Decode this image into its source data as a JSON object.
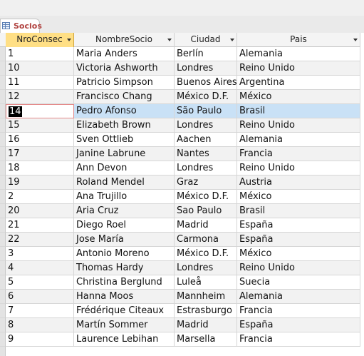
{
  "tab": {
    "label": "Socios",
    "icon": "table-icon"
  },
  "columns": [
    "NroConsec",
    "NombreSocio",
    "Ciudad",
    "Pais"
  ],
  "active_column": "NroConsec",
  "current_row": 4,
  "rows": [
    [
      "1",
      "Maria Anders",
      "Berlín",
      "Alemania"
    ],
    [
      "10",
      "Victoria Ashworth",
      "Londres",
      "Reino Unido"
    ],
    [
      "11",
      "Patricio Simpson",
      "Buenos Aires",
      "Argentina"
    ],
    [
      "12",
      "Francisco Chang",
      "México D.F.",
      "México"
    ],
    [
      "14",
      "Pedro Afonso",
      "São Paulo",
      "Brasil"
    ],
    [
      "15",
      "Elizabeth Brown",
      "Londres",
      "Reino Unido"
    ],
    [
      "16",
      "Sven Ottlieb",
      "Aachen",
      "Alemania"
    ],
    [
      "17",
      "Janine Labrune",
      "Nantes",
      "Francia"
    ],
    [
      "18",
      "Ann Devon",
      "Londres",
      "Reino Unido"
    ],
    [
      "19",
      "Roland Mendel",
      "Graz",
      "Austria"
    ],
    [
      "2",
      "Ana Trujillo",
      "México D.F.",
      "México"
    ],
    [
      "20",
      "Aria Cruz",
      "Sao Paulo",
      "Brasil"
    ],
    [
      "21",
      "Diego Roel",
      "Madrid",
      "España"
    ],
    [
      "22",
      "Jose María",
      "Carmona",
      "España"
    ],
    [
      "3",
      "Antonio Moreno",
      "México D.F.",
      "México"
    ],
    [
      "4",
      "Thomas Hardy",
      "Londres",
      "Reino Unido"
    ],
    [
      "5",
      "Christina Berglund",
      "Luleå",
      "Suecia"
    ],
    [
      "6",
      "Hanna Moos",
      "Mannheim",
      "Alemania"
    ],
    [
      "7",
      "Frédérique Citeaux",
      "Estrasburgo",
      "Francia"
    ],
    [
      "8",
      "Martín Sommer",
      "Madrid",
      "España"
    ],
    [
      "9",
      "Laurence Lebihan",
      "Marsella",
      "Francia"
    ]
  ]
}
